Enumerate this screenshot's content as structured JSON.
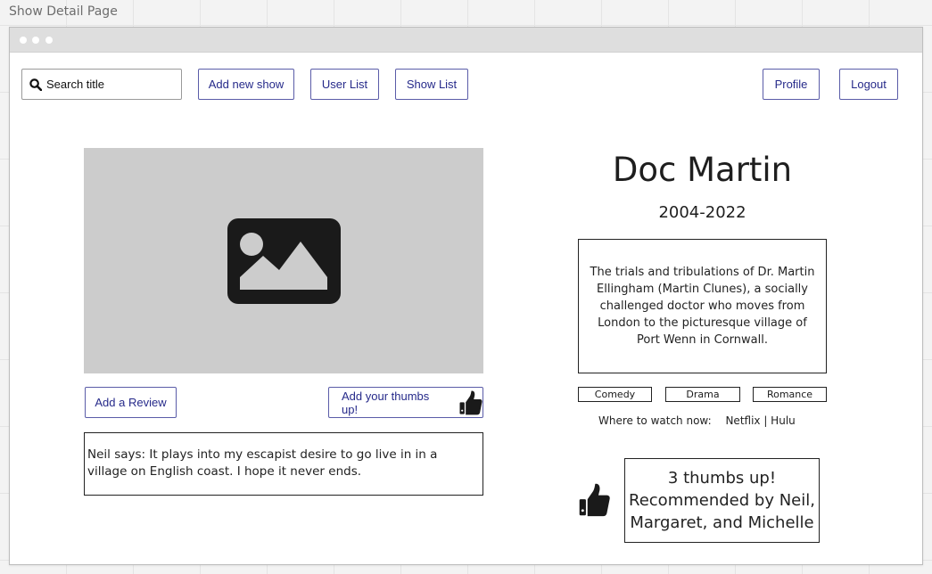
{
  "board": {
    "title": "Show Detail Page"
  },
  "header": {
    "search_placeholder": "Search title",
    "add_show_label": "Add new show",
    "user_list_label": "User List",
    "show_list_label": "Show List",
    "profile_label": "Profile",
    "logout_label": "Logout"
  },
  "show": {
    "title": "Doc Martin",
    "years": "2004-2022",
    "description": "The trials and tribulations of Dr. Martin Ellingham (Martin Clunes), a socially challenged doctor who moves from London to the picturesque village of Port Wenn in Cornwall.",
    "genres": [
      "Comedy",
      "Drama",
      "Romance"
    ],
    "where_to_watch_label": "Where to watch now:",
    "where_to_watch_value": "Netflix | Hulu"
  },
  "actions": {
    "add_review_label": "Add a Review",
    "add_thumbs_label": "Add your thumbs up!"
  },
  "review": {
    "text": "Neil says: It plays into my escapist desire to go live in in a village on English coast. I hope it never ends."
  },
  "recommendation": {
    "line1": "3 thumbs up!",
    "line2": "Recommended by Neil,",
    "line3": "Margaret, and Michelle"
  },
  "icons": {
    "search": "search-icon",
    "image": "image-icon",
    "thumbs_up": "thumbs-up-icon"
  }
}
